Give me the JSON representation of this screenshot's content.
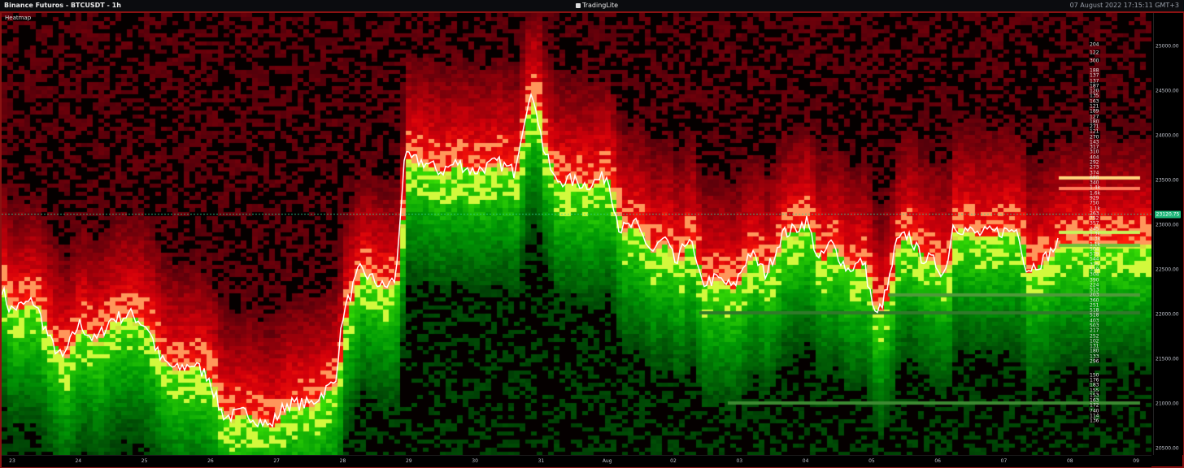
{
  "header": {
    "chart_title": "Binance Futuros - BTCUSDT - 1h",
    "brand": "TradingLite",
    "datetime": "07 August 2022 17:15:11 GMT+3"
  },
  "indicator_label": "Heatmap",
  "current_price": "23120.75",
  "x_labels": [
    "23",
    "24",
    "25",
    "26",
    "27",
    "28",
    "29",
    "30",
    "31",
    "Aug",
    "02",
    "03",
    "04",
    "05",
    "06",
    "07",
    "08",
    "09"
  ],
  "y_labels": [
    "25000.00",
    "24500.00",
    "24000.00",
    "23500.00",
    "23000.00",
    "22500.00",
    "22000.00",
    "21500.00",
    "21000.00",
    "20500.00"
  ],
  "level_values": [
    "204",
    "122",
    "300",
    "188",
    "137",
    "137",
    "187",
    "120",
    "135",
    "163",
    "121",
    "189",
    "127",
    "180",
    "271",
    "121",
    "270",
    "143",
    "317",
    "310",
    "404",
    "292",
    "273",
    "374",
    "680",
    "340",
    "1.4k",
    "1.6k",
    "929",
    "750",
    "1.1k",
    "263",
    "752",
    "357",
    "245",
    "1.3k",
    "1.3k",
    "1.1k",
    "504",
    "579",
    "544",
    "375",
    "519",
    "304",
    "390",
    "224",
    "513",
    "203",
    "360",
    "251",
    "518",
    "518",
    "403",
    "503",
    "217",
    "252",
    "102",
    "131",
    "180",
    "133",
    "296",
    "150",
    "176",
    "183",
    "155",
    "153",
    "163",
    "172",
    "740",
    "114",
    "136"
  ],
  "colors": {
    "border": "#8b1212",
    "price_line": "#ffffff",
    "current_price_tag": "#1fb87a",
    "ask_heat": "#e0242a",
    "bid_heat": "#b8ee3a"
  }
}
